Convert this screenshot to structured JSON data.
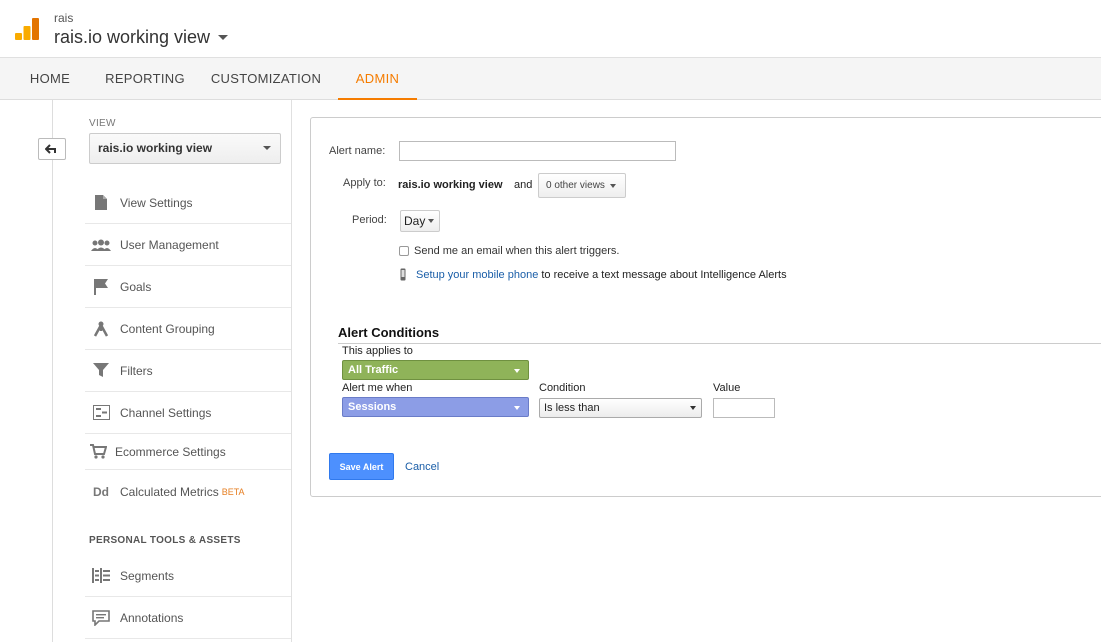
{
  "header": {
    "account": "rais",
    "property": "rais.io working view"
  },
  "tabs": [
    {
      "label": "HOME"
    },
    {
      "label": "REPORTING"
    },
    {
      "label": "CUSTOMIZATION"
    },
    {
      "label": "ADMIN"
    }
  ],
  "sidebar": {
    "view_label": "VIEW",
    "view_selected": "rais.io working view",
    "items": [
      {
        "label": "View Settings",
        "icon": "document-icon"
      },
      {
        "label": "User Management",
        "icon": "users-icon"
      },
      {
        "label": "Goals",
        "icon": "flag-icon"
      },
      {
        "label": "Content Grouping",
        "icon": "grouping-icon"
      },
      {
        "label": "Filters",
        "icon": "funnel-icon"
      },
      {
        "label": "Channel Settings",
        "icon": "channel-icon"
      },
      {
        "label": "Ecommerce Settings",
        "icon": "cart-icon"
      },
      {
        "label": "Calculated Metrics",
        "icon": "dd-icon",
        "badge": "BETA"
      }
    ],
    "section_heading": "PERSONAL TOOLS & ASSETS",
    "tools": [
      {
        "label": "Segments",
        "icon": "segments-icon"
      },
      {
        "label": "Annotations",
        "icon": "annotations-icon"
      }
    ]
  },
  "form": {
    "alert_name_label": "Alert name:",
    "alert_name_value": "",
    "apply_to_label": "Apply to:",
    "apply_to_view": "rais.io working view",
    "apply_to_and": "and",
    "other_views": "0 other views",
    "period_label": "Period:",
    "period_value": "Day",
    "email_checkbox_label": "Send me an email when this alert triggers.",
    "mobile_link": "Setup your mobile phone",
    "mobile_text": "to receive a text message about Intelligence Alerts"
  },
  "conditions": {
    "title": "Alert Conditions",
    "applies_to_label": "This applies to",
    "applies_to_value": "All Traffic",
    "alert_when_label": "Alert me when",
    "alert_when_value": "Sessions",
    "condition_label": "Condition",
    "condition_value": "Is less than",
    "value_label": "Value",
    "value_value": ""
  },
  "actions": {
    "save": "Save Alert",
    "cancel": "Cancel"
  },
  "colors": {
    "accent": "#f57c00",
    "primary_button": "#4d90fe",
    "traffic_dropdown": "#8fb359",
    "metric_dropdown": "#8c9de6",
    "link": "#1a5ea8"
  }
}
